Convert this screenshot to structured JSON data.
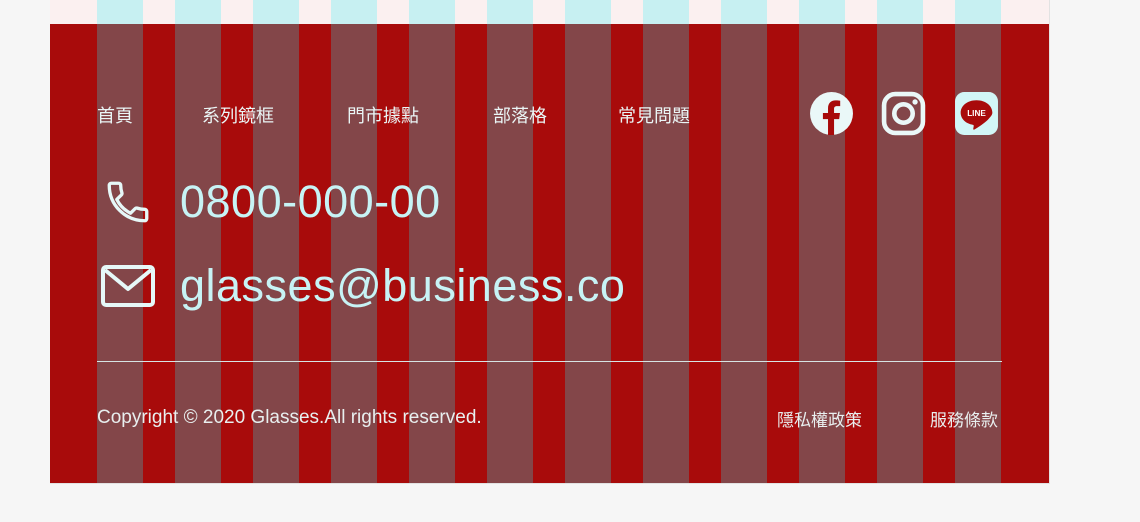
{
  "nav": {
    "items": [
      {
        "label": "首頁"
      },
      {
        "label": "系列鏡框"
      },
      {
        "label": "門市據點"
      },
      {
        "label": "部落格"
      },
      {
        "label": "常見問題"
      }
    ]
  },
  "social": {
    "icons": [
      "facebook-icon",
      "instagram-icon",
      "line-icon"
    ],
    "line_text": "LINE"
  },
  "contact": {
    "phone": "0800-000-00",
    "email": "glasses@business.co"
  },
  "footer": {
    "copyright": "Copyright © 2020 Glasses.All rights reserved.",
    "legal_links": [
      {
        "label": "隱私權政策"
      },
      {
        "label": "服務條款"
      }
    ]
  },
  "colors": {
    "footer_bg": "#a80b0b",
    "grid_overlay": "#7b6f6f",
    "accent": "#c7f3f5"
  }
}
